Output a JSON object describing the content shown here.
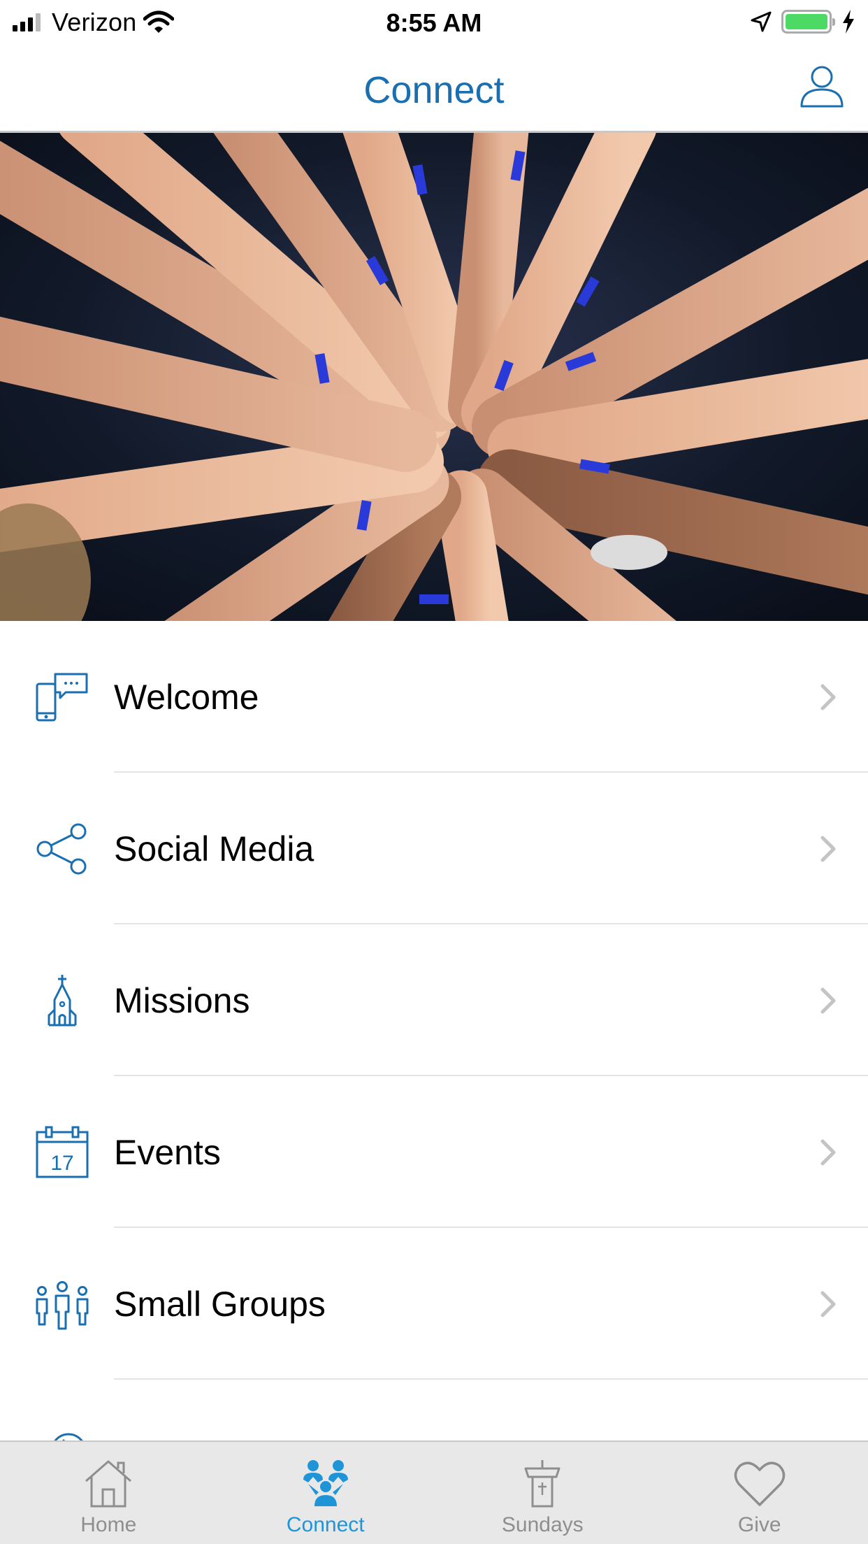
{
  "status_bar": {
    "carrier": "Verizon",
    "time": "8:55 AM",
    "battery_level": 1.0
  },
  "header": {
    "title": "Connect",
    "profile_icon": "person-outline-icon"
  },
  "hero": {
    "image": "hands-together-photo"
  },
  "menu": {
    "items": [
      {
        "label": "Welcome",
        "icon": "phone-chat-icon"
      },
      {
        "label": "Social Media",
        "icon": "share-icon"
      },
      {
        "label": "Missions",
        "icon": "church-icon"
      },
      {
        "label": "Events",
        "icon": "calendar-icon",
        "icon_text": "17"
      },
      {
        "label": "Small Groups",
        "icon": "people-group-icon"
      }
    ]
  },
  "tabs": [
    {
      "label": "Home",
      "icon": "house-icon",
      "active": false
    },
    {
      "label": "Connect",
      "icon": "connect-people-icon",
      "active": true
    },
    {
      "label": "Sundays",
      "icon": "pulpit-icon",
      "active": false
    },
    {
      "label": "Give",
      "icon": "heart-icon",
      "active": false
    }
  ],
  "colors": {
    "accent": "#1a6fb0",
    "active_tab": "#1f95d8",
    "inactive_tab": "#8e8e8e",
    "battery": "#4cd964"
  }
}
